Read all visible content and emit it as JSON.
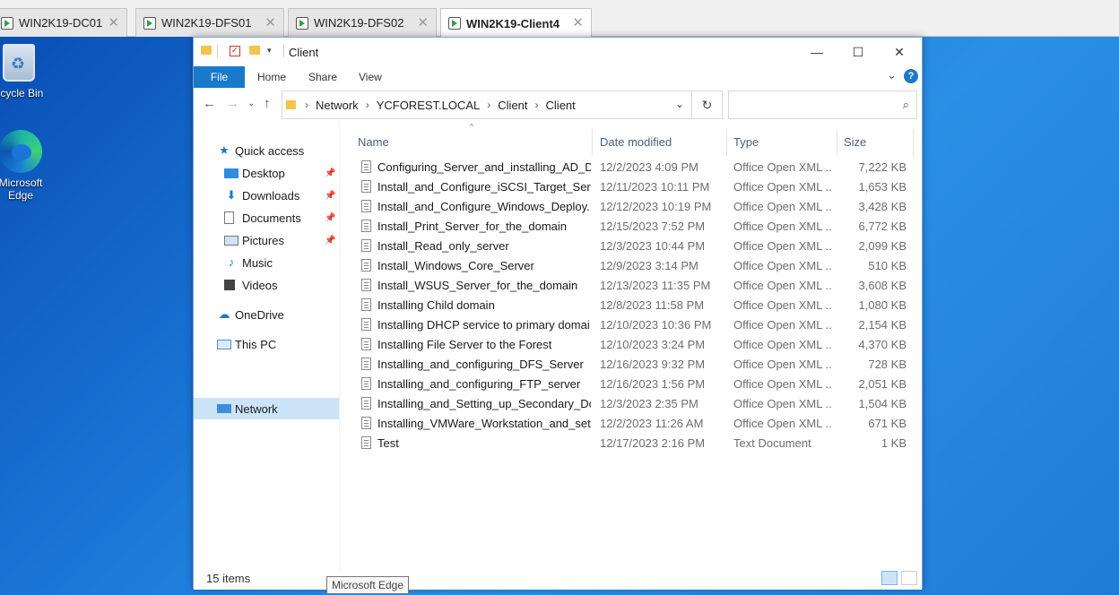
{
  "vm_tabs": [
    {
      "label": "WIN2K19-DC01",
      "active": false
    },
    {
      "label": "WIN2K19-DFS01",
      "active": false
    },
    {
      "label": "WIN2K19-DFS02",
      "active": false
    },
    {
      "label": "WIN2K19-Client4",
      "active": true
    }
  ],
  "desktop": {
    "recycle_bin_label": "ecycle Bin",
    "edge_label_line1": "Microsoft",
    "edge_label_line2": "Edge"
  },
  "explorer": {
    "title": "Client",
    "ribbon_tabs": {
      "file": "File",
      "home": "Home",
      "share": "Share",
      "view": "View"
    },
    "help": "?",
    "breadcrumb": [
      "Network",
      "YCFOREST.LOCAL",
      "Client",
      "Client"
    ],
    "search_placeholder": "",
    "nav": {
      "quick_access": "Quick access",
      "desktop": "Desktop",
      "downloads": "Downloads",
      "documents": "Documents",
      "pictures": "Pictures",
      "music": "Music",
      "videos": "Videos",
      "onedrive": "OneDrive",
      "this_pc": "This PC",
      "network": "Network"
    },
    "columns": {
      "name": "Name",
      "date": "Date modified",
      "type": "Type",
      "size": "Size"
    },
    "files": [
      {
        "name": "Configuring_Server_and_installing_AD_D...",
        "date": "12/2/2023 4:09 PM",
        "type": "Office Open XML ...",
        "size": "7,222 KB"
      },
      {
        "name": "Install_and_Configure_iSCSI_Target_Server",
        "date": "12/11/2023 10:11 PM",
        "type": "Office Open XML ...",
        "size": "1,653 KB"
      },
      {
        "name": "Install_and_Configure_Windows_Deploy...",
        "date": "12/12/2023 10:19 PM",
        "type": "Office Open XML ...",
        "size": "3,428 KB"
      },
      {
        "name": "Install_Print_Server_for_the_domain",
        "date": "12/15/2023 7:52 PM",
        "type": "Office Open XML ...",
        "size": "6,772 KB"
      },
      {
        "name": "Install_Read_only_server",
        "date": "12/3/2023 10:44 PM",
        "type": "Office Open XML ...",
        "size": "2,099 KB"
      },
      {
        "name": "Install_Windows_Core_Server",
        "date": "12/9/2023 3:14 PM",
        "type": "Office Open XML ...",
        "size": "510 KB"
      },
      {
        "name": "Install_WSUS_Server_for_the_domain",
        "date": "12/13/2023 11:35 PM",
        "type": "Office Open XML ...",
        "size": "3,608 KB"
      },
      {
        "name": "Installing Child domain",
        "date": "12/8/2023 11:58 PM",
        "type": "Office Open XML ...",
        "size": "1,080 KB"
      },
      {
        "name": "Installing DHCP service to primary domai...",
        "date": "12/10/2023 10:36 PM",
        "type": "Office Open XML ...",
        "size": "2,154 KB"
      },
      {
        "name": "Installing File Server to the Forest",
        "date": "12/10/2023 3:24 PM",
        "type": "Office Open XML ...",
        "size": "4,370 KB"
      },
      {
        "name": "Installing_and_configuring_DFS_Server",
        "date": "12/16/2023 9:32 PM",
        "type": "Office Open XML ...",
        "size": "728 KB"
      },
      {
        "name": "Installing_and_configuring_FTP_server",
        "date": "12/16/2023 1:56 PM",
        "type": "Office Open XML ...",
        "size": "2,051 KB"
      },
      {
        "name": "Installing_and_Setting_up_Secondary_Do...",
        "date": "12/3/2023 2:35 PM",
        "type": "Office Open XML ...",
        "size": "1,504 KB"
      },
      {
        "name": "Installing_VMWare_Workstation_and_sett...",
        "date": "12/2/2023 11:26 AM",
        "type": "Office Open XML ...",
        "size": "671 KB"
      },
      {
        "name": "Test",
        "date": "12/17/2023 2:16 PM",
        "type": "Text Document",
        "size": "1 KB"
      }
    ],
    "status": "15 items"
  },
  "tooltip": "Microsoft Edge"
}
